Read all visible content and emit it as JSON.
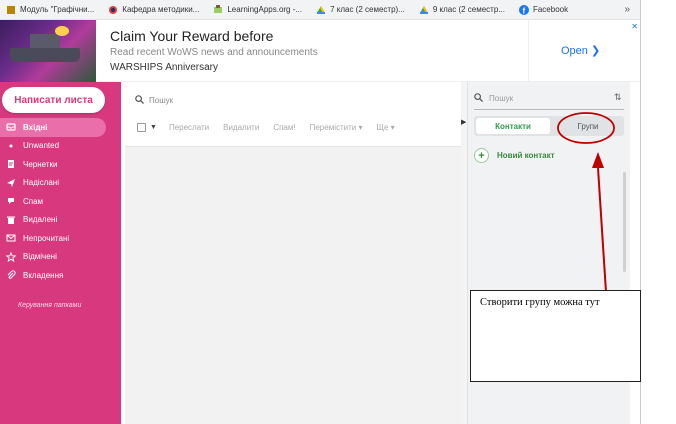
{
  "bookmarks": [
    {
      "label": "Модуль \"Графічни...",
      "icon": "module-icon"
    },
    {
      "label": "Кафедра методики...",
      "icon": "department-icon"
    },
    {
      "label": "LearningApps.org -...",
      "icon": "learningapps-icon"
    },
    {
      "label": "7 клас (2 семестр)...",
      "icon": "drive-icon"
    },
    {
      "label": "9 клас (2 семестр...",
      "icon": "drive-icon"
    },
    {
      "label": "Facebook",
      "icon": "facebook-icon"
    }
  ],
  "bookmarks_more": "»",
  "ad": {
    "title": "Claim Your Reward before",
    "subtitle": "Read recent WoWS news and announcements",
    "brand": "WARSHIPS Anniversary",
    "open_label": "Open",
    "close": "✕"
  },
  "sidebar": {
    "compose_label": "Написати листа",
    "items": [
      {
        "label": "Вхідні",
        "icon": "inbox-icon",
        "active": true
      },
      {
        "label": "Unwanted",
        "icon": "dot-icon",
        "active": false
      },
      {
        "label": "Чернетки",
        "icon": "draft-icon",
        "active": false
      },
      {
        "label": "Надіслані",
        "icon": "sent-icon",
        "active": false
      },
      {
        "label": "Спам",
        "icon": "spam-icon",
        "active": false
      },
      {
        "label": "Видалені",
        "icon": "trash-icon",
        "active": false
      },
      {
        "label": "Непрочитані",
        "icon": "unread-icon",
        "active": false
      },
      {
        "label": "Відмічені",
        "icon": "star-icon",
        "active": false
      },
      {
        "label": "Вкладення",
        "icon": "attachment-icon",
        "active": false
      }
    ],
    "manage_folders": "Керування папками"
  },
  "mail": {
    "search_placeholder": "Пошук",
    "toolbar": {
      "forward": "Переслати",
      "delete": "Видалити",
      "spam": "Спам!",
      "move": "Перемістити",
      "more": "Ще"
    }
  },
  "contacts_panel": {
    "search_placeholder": "Пошук",
    "tab_contacts": "Контакти",
    "tab_groups": "Групи",
    "new_contact": "Новий контакт"
  },
  "annotation": {
    "text": "Створити групу можна тут",
    "color": "#c00000"
  },
  "colors": {
    "sidebar": "#d8397e",
    "active_item": "#ea6ea9",
    "contacts_accent": "#2f9a4a"
  }
}
